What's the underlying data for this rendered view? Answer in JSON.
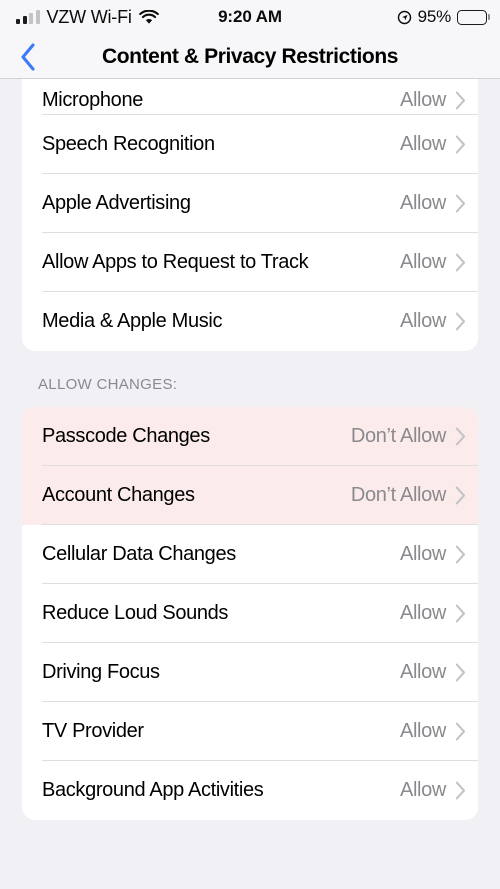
{
  "status_bar": {
    "carrier": "VZW Wi-Fi",
    "wifi_icon": "wifi-icon",
    "signal_icon": "cellular-signal-icon",
    "time": "9:20 AM",
    "location_icon": "location-arrow-icon",
    "battery_percent": "95%",
    "battery_icon": "battery-full-icon"
  },
  "nav": {
    "back_icon": "chevron-left-icon",
    "title": "Content & Privacy Restrictions",
    "accent_color": "#3C7BF6"
  },
  "colors": {
    "page_background": "#F0F0F5",
    "card_background": "#FFFFFF",
    "highlight_background": "#FCEBEB",
    "separator": "#DEDEE1",
    "value_text": "#8A8A8E",
    "chevron": "#C4C4C6"
  },
  "sections": [
    {
      "header": null,
      "rows": [
        {
          "label": "Microphone",
          "value": "Allow",
          "chevron_icon": "chevron-right-icon",
          "highlighted": false,
          "clipped": true
        },
        {
          "label": "Speech Recognition",
          "value": "Allow",
          "chevron_icon": "chevron-right-icon",
          "highlighted": false
        },
        {
          "label": "Apple Advertising",
          "value": "Allow",
          "chevron_icon": "chevron-right-icon",
          "highlighted": false
        },
        {
          "label": "Allow Apps to Request to Track",
          "value": "Allow",
          "chevron_icon": "chevron-right-icon",
          "highlighted": false
        },
        {
          "label": "Media & Apple Music",
          "value": "Allow",
          "chevron_icon": "chevron-right-icon",
          "highlighted": false
        }
      ]
    },
    {
      "header": "ALLOW CHANGES:",
      "rows": [
        {
          "label": "Passcode Changes",
          "value": "Don’t Allow",
          "chevron_icon": "chevron-right-icon",
          "highlighted": true
        },
        {
          "label": "Account Changes",
          "value": "Don’t Allow",
          "chevron_icon": "chevron-right-icon",
          "highlighted": true
        },
        {
          "label": "Cellular Data Changes",
          "value": "Allow",
          "chevron_icon": "chevron-right-icon",
          "highlighted": false
        },
        {
          "label": "Reduce Loud Sounds",
          "value": "Allow",
          "chevron_icon": "chevron-right-icon",
          "highlighted": false
        },
        {
          "label": "Driving Focus",
          "value": "Allow",
          "chevron_icon": "chevron-right-icon",
          "highlighted": false
        },
        {
          "label": "TV Provider",
          "value": "Allow",
          "chevron_icon": "chevron-right-icon",
          "highlighted": false
        },
        {
          "label": "Background App Activities",
          "value": "Allow",
          "chevron_icon": "chevron-right-icon",
          "highlighted": false
        }
      ]
    }
  ]
}
